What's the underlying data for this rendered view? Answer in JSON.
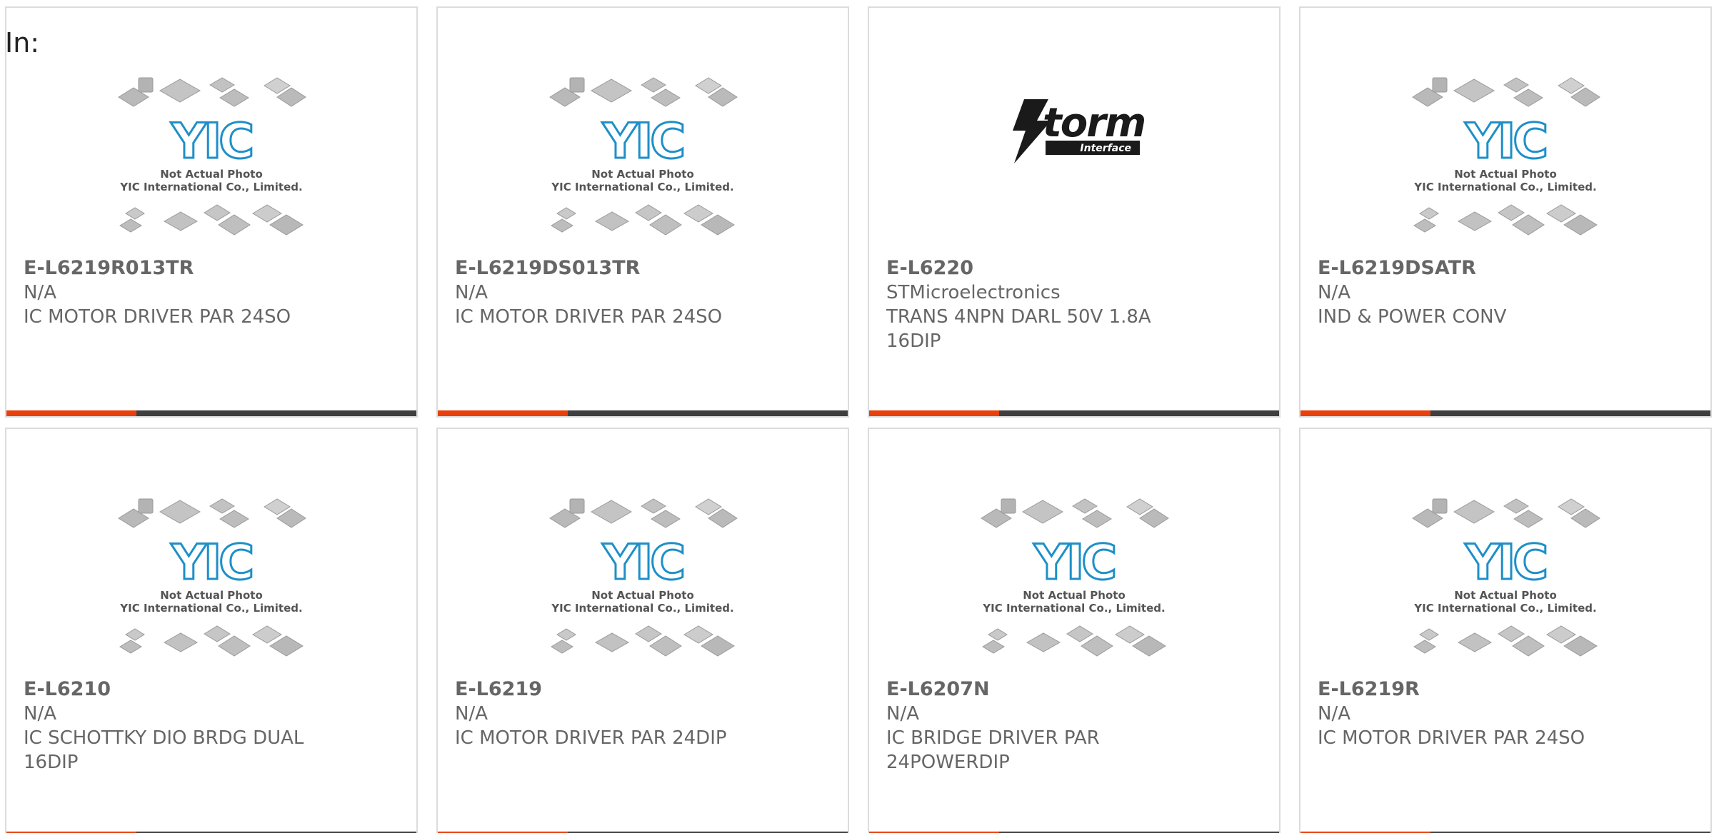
{
  "header": {
    "in_label": "In:"
  },
  "placeholder": {
    "line1": "Not Actual Photo",
    "line2": "YIC International Co., Limited.",
    "logo_text": "YIC",
    "logo_color": "#1e8fc8"
  },
  "storm_logo": {
    "word": "torm",
    "sub": "Interface"
  },
  "colors": {
    "accent": "#e8400c",
    "bar": "#3f3f3f",
    "text": "#666666",
    "border": "#dcdcdc"
  },
  "cards": [
    {
      "part": "E-L6219R013TR",
      "manufacturer": "N/A",
      "description": "IC MOTOR DRIVER PAR 24SO",
      "image": "yic-placeholder"
    },
    {
      "part": "E-L6219DS013TR",
      "manufacturer": "N/A",
      "description": "IC MOTOR DRIVER PAR 24SO",
      "image": "yic-placeholder"
    },
    {
      "part": "E-L6220",
      "manufacturer": "STMicroelectronics",
      "description": "TRANS 4NPN DARL 50V 1.8A 16DIP",
      "image": "storm-logo"
    },
    {
      "part": "E-L6219DSATR",
      "manufacturer": "N/A",
      "description": "IND & POWER CONV",
      "image": "yic-placeholder"
    },
    {
      "part": "E-L6210",
      "manufacturer": "N/A",
      "description": "IC SCHOTTKY DIO BRDG DUAL 16DIP",
      "image": "yic-placeholder"
    },
    {
      "part": "E-L6219",
      "manufacturer": "N/A",
      "description": "IC MOTOR DRIVER PAR 24DIP",
      "image": "yic-placeholder"
    },
    {
      "part": "E-L6207N",
      "manufacturer": "N/A",
      "description": "IC BRIDGE DRIVER PAR 24POWERDIP",
      "image": "yic-placeholder"
    },
    {
      "part": "E-L6219R",
      "manufacturer": "N/A",
      "description": "IC MOTOR DRIVER PAR 24SO",
      "image": "yic-placeholder"
    }
  ]
}
